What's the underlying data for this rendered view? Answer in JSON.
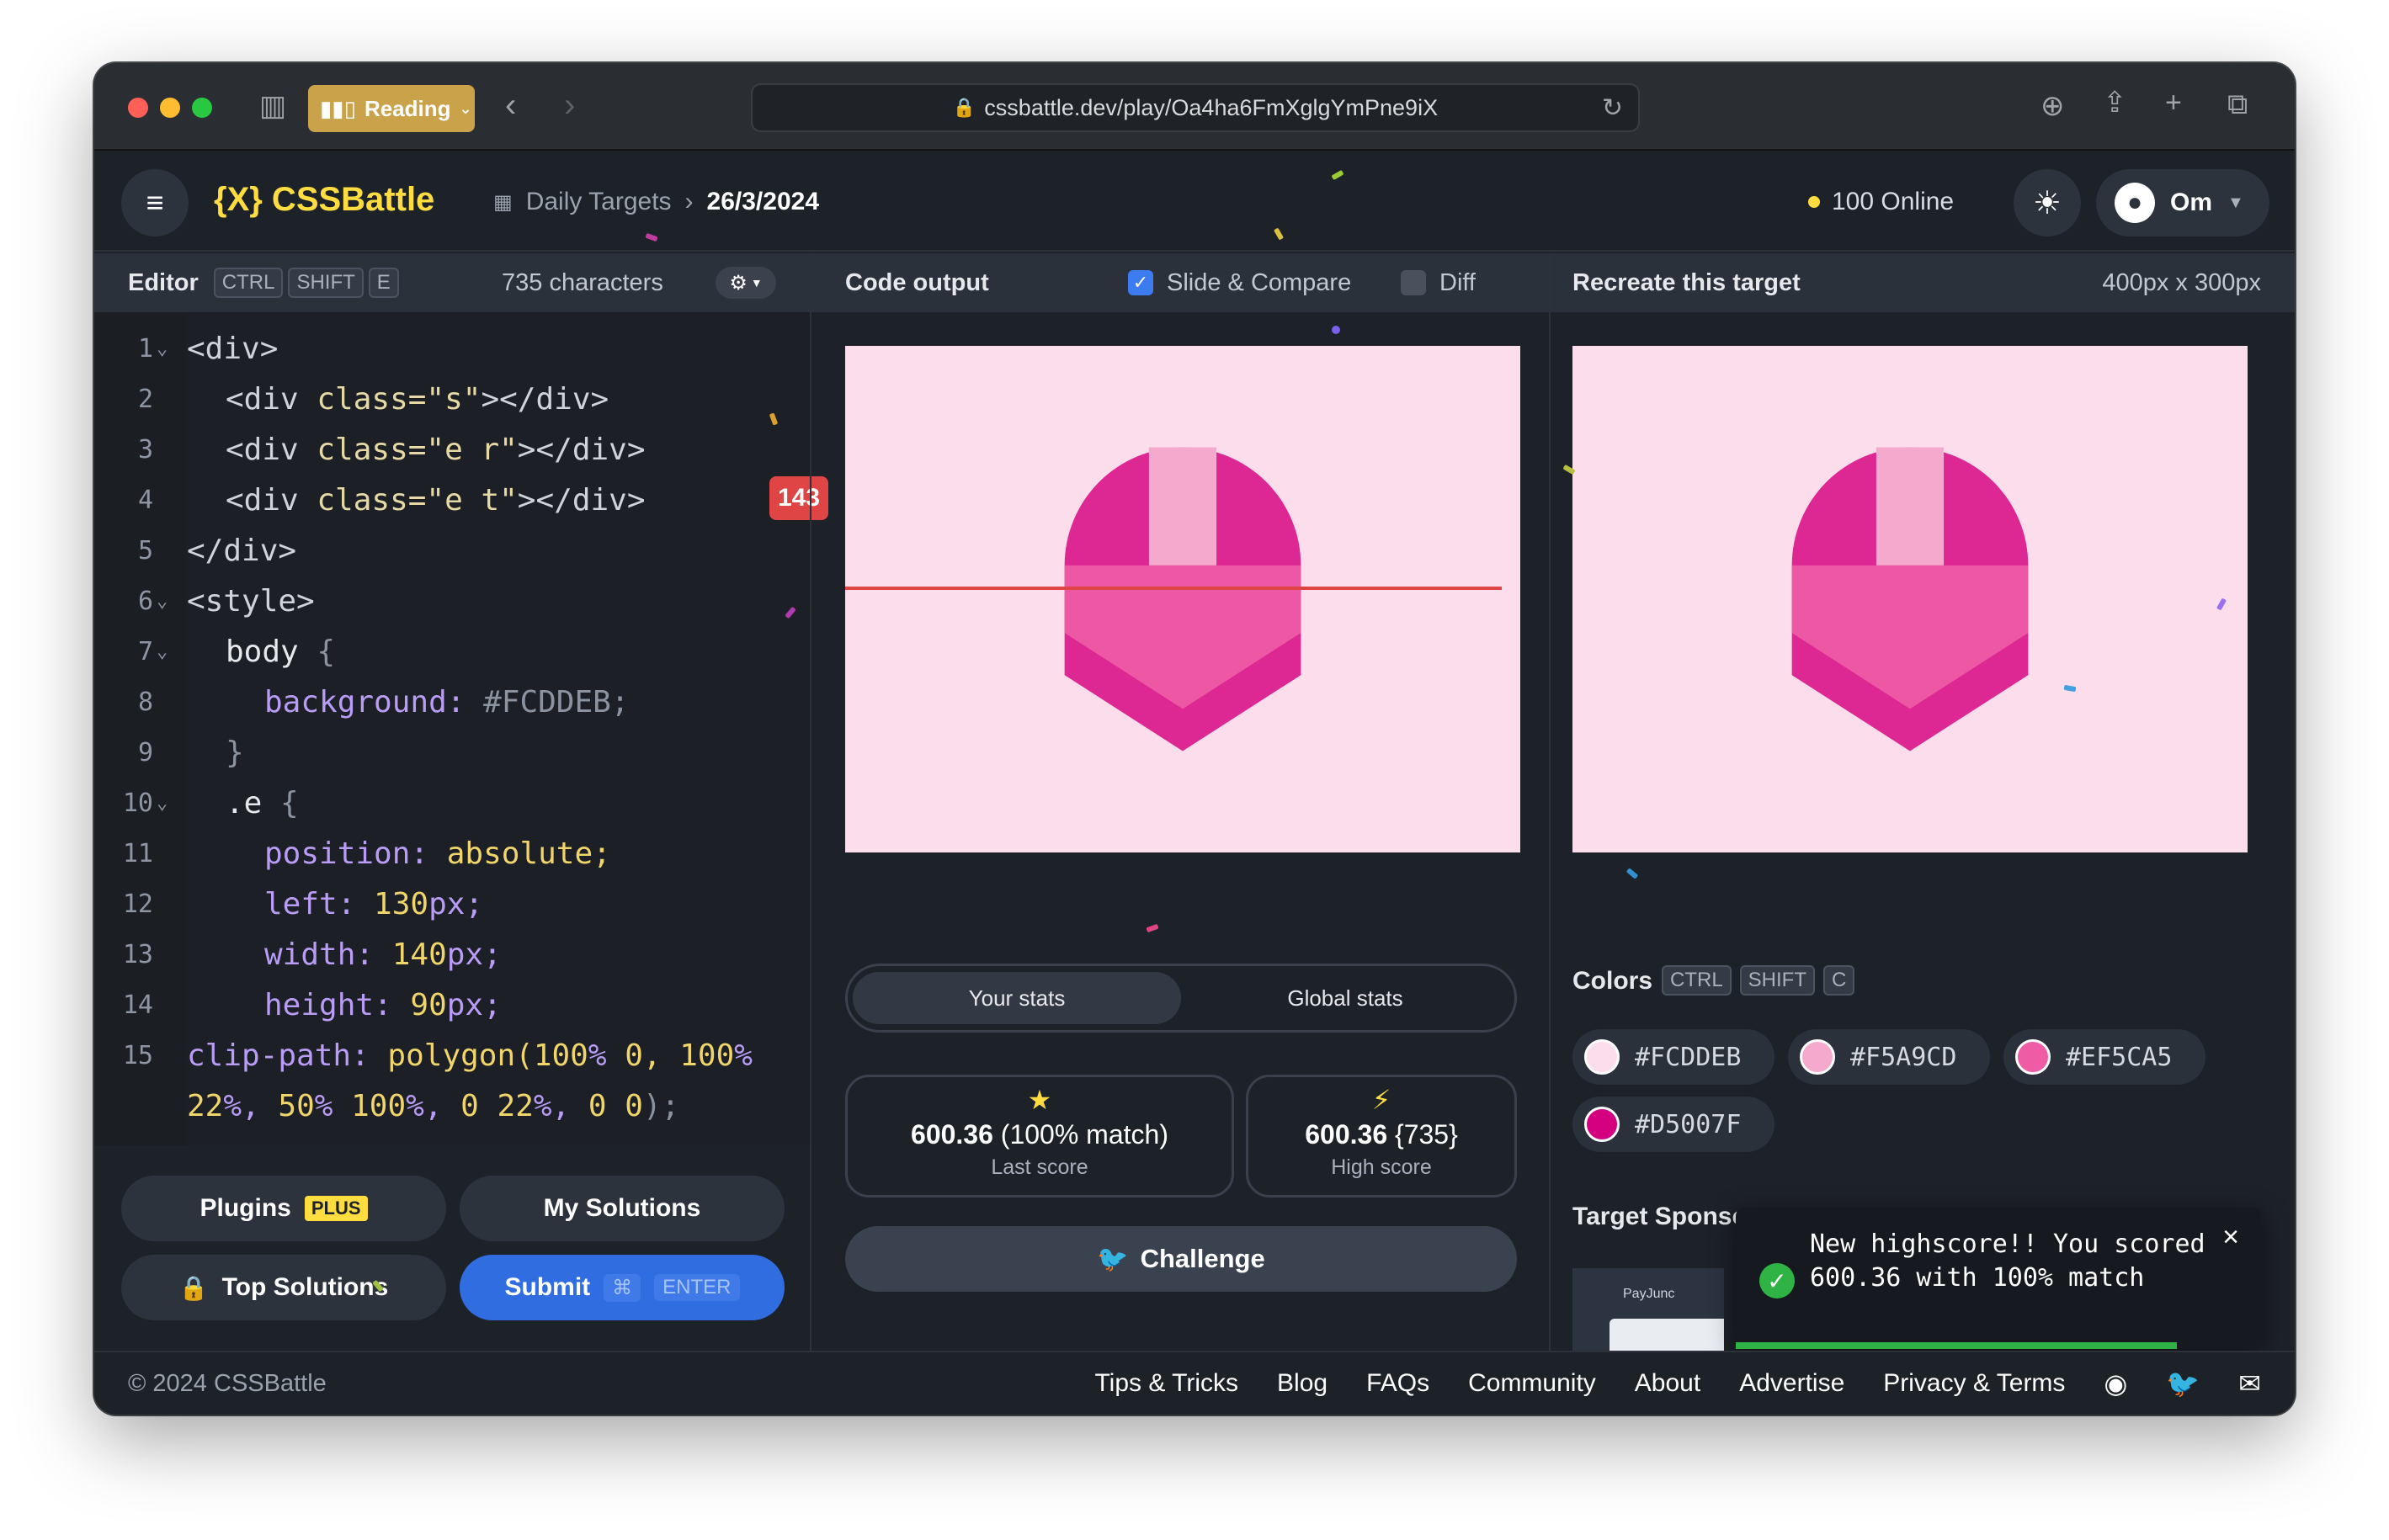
{
  "browser": {
    "reading_label": "Reading",
    "url": "cssbattle.dev/play/Oa4ha6FmXglgYmPne9iX"
  },
  "header": {
    "logo": "{X} CSSBattle",
    "breadcrumb_link": "Daily Targets",
    "breadcrumb_current": "26/3/2024",
    "online": "100 Online",
    "user": "Om"
  },
  "editor": {
    "title": "Editor",
    "shortcut": [
      "CTRL",
      "SHIFT",
      "E"
    ],
    "chars": "735 characters"
  },
  "output": {
    "title": "Code output",
    "slide_compare": "Slide & Compare",
    "diff": "Diff",
    "diff_value": "143",
    "stats_tabs": [
      "Your stats",
      "Global stats"
    ],
    "last_score_value": "600.36",
    "last_score_match": "(100% match)",
    "last_score_label": "Last score",
    "high_score_value": "600.36",
    "high_score_chars": "{735}",
    "high_score_label": "High score",
    "challenge": "Challenge"
  },
  "target": {
    "title": "Recreate this target",
    "size": "400px x 300px",
    "colors_title": "Colors",
    "colors_shortcut": [
      "CTRL",
      "SHIFT",
      "C"
    ],
    "colors": [
      "#FCDDEB",
      "#F5A9CD",
      "#EF5CA5",
      "#D5007F"
    ],
    "sponsor_title": "Target Sponsor",
    "sponsor_brand": "PayJunc"
  },
  "buttons": {
    "plugins": "Plugins",
    "plus": "PLUS",
    "my_solutions": "My Solutions",
    "top_solutions": "Top Solutions",
    "submit": "Submit",
    "submit_cmd": "⌘",
    "submit_enter": "ENTER"
  },
  "toast": {
    "message": "New highscore!! You scored 600.36 with 100% match"
  },
  "footer": {
    "copyright": "© 2024 CSSBattle",
    "links": [
      "Tips & Tricks",
      "Blog",
      "FAQs",
      "Community",
      "About",
      "Advertise",
      "Privacy & Terms"
    ]
  },
  "code_lines": [
    {
      "n": "1",
      "fold": true
    },
    {
      "n": "2",
      "fold": false
    },
    {
      "n": "3",
      "fold": false
    },
    {
      "n": "4",
      "fold": false
    },
    {
      "n": "5",
      "fold": false
    },
    {
      "n": "6",
      "fold": true
    },
    {
      "n": "7",
      "fold": true
    },
    {
      "n": "8",
      "fold": false
    },
    {
      "n": "9",
      "fold": false
    },
    {
      "n": "10",
      "fold": true
    },
    {
      "n": "11",
      "fold": false
    },
    {
      "n": "12",
      "fold": false
    },
    {
      "n": "13",
      "fold": false
    },
    {
      "n": "14",
      "fold": false
    },
    {
      "n": "15",
      "fold": false
    }
  ],
  "code": {
    "l1": "<div>",
    "l2_a": "<div ",
    "l2_b": "class=",
    "l2_c": "\"s\"",
    "l2_d": "></div>",
    "l3_a": "<div ",
    "l3_b": "class=",
    "l3_c": "\"e r\"",
    "l3_d": "></div>",
    "l4_a": "<div ",
    "l4_b": "class=",
    "l4_c": "\"e t\"",
    "l4_d": "></div>",
    "l5": "</div>",
    "l6": "<style>",
    "l7_a": "body ",
    "l7_b": "{",
    "l8_a": "background: ",
    "l8_b": "#FCDDEB;",
    "l9": "}",
    "l10_a": ".e ",
    "l10_b": "{",
    "l11_a": "position: ",
    "l11_b": "absolute;",
    "l12_a": "left: ",
    "l12_b": "130",
    "l12_c": "px;",
    "l13_a": "width: ",
    "l13_b": "140",
    "l13_c": "px;",
    "l14_a": "height: ",
    "l14_b": "90",
    "l14_c": "px;",
    "l15_a": "clip-path: ",
    "l15_b": "polygon(",
    "l15_c": "100",
    "l15_d": "% ",
    "l15_e": "0, ",
    "l15_f": "100",
    "l15_g": "%",
    "l16_a": "22",
    "l16_b": "%, ",
    "l16_c": "50",
    "l16_d": "% ",
    "l16_e": "100",
    "l16_f": "%, ",
    "l16_g": "0 22",
    "l16_h": "%, ",
    "l16_i": "0 0",
    "l16_j": ");"
  },
  "colors": {
    "accent": "#FFDD40",
    "primary_button": "#2F6DE1",
    "diff_red": "#E04545",
    "success": "#2FB344"
  }
}
